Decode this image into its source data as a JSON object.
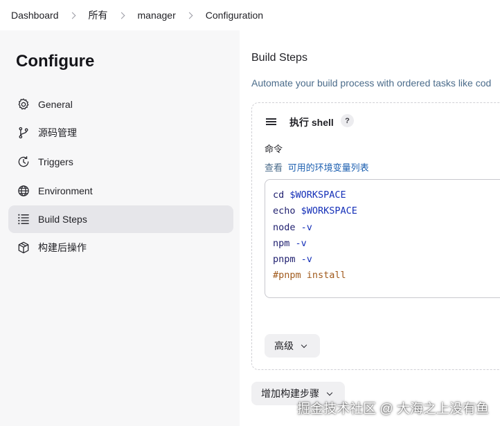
{
  "breadcrumb": {
    "items": [
      "Dashboard",
      "所有",
      "manager",
      "Configuration"
    ]
  },
  "sidebar": {
    "title": "Configure",
    "items": [
      {
        "label": "General",
        "icon": "gear-icon",
        "active": false
      },
      {
        "label": "源码管理",
        "icon": "git-branch-icon",
        "active": false
      },
      {
        "label": "Triggers",
        "icon": "clock-icon",
        "active": false
      },
      {
        "label": "Environment",
        "icon": "globe-icon",
        "active": false
      },
      {
        "label": "Build Steps",
        "icon": "list-icon",
        "active": true
      },
      {
        "label": "构建后操作",
        "icon": "package-icon",
        "active": false
      }
    ]
  },
  "main": {
    "section_title": "Build Steps",
    "section_description": "Automate your build process with ordered tasks like cod",
    "step": {
      "title": "执行 shell",
      "help": "?",
      "field_label": "命令",
      "help_prefix": "查看",
      "help_link": "可用的环境变量列表",
      "code_lines": [
        {
          "cmd": "cd",
          "arg": "$WORKSPACE",
          "comment": ""
        },
        {
          "cmd": "echo",
          "arg": "$WORKSPACE",
          "comment": ""
        },
        {
          "cmd": "node",
          "arg": "-v",
          "comment": ""
        },
        {
          "cmd": "npm",
          "arg": "-v",
          "comment": ""
        },
        {
          "cmd": "pnpm",
          "arg": "-v",
          "comment": ""
        },
        {
          "cmd": "",
          "arg": "",
          "comment": "#pnpm install"
        }
      ],
      "advanced_label": "高级"
    },
    "add_step_label": "增加构建步骤"
  },
  "watermark": "掘金技术社区 @ 大海之上没有鱼",
  "colors": {
    "sidebar_bg": "#f7f7f8",
    "active_item_bg": "#e6e6ea",
    "link": "#1c5fb0",
    "description": "#4a6b8a",
    "code_variable": "#1530b8",
    "code_comment": "#a05a1c"
  }
}
